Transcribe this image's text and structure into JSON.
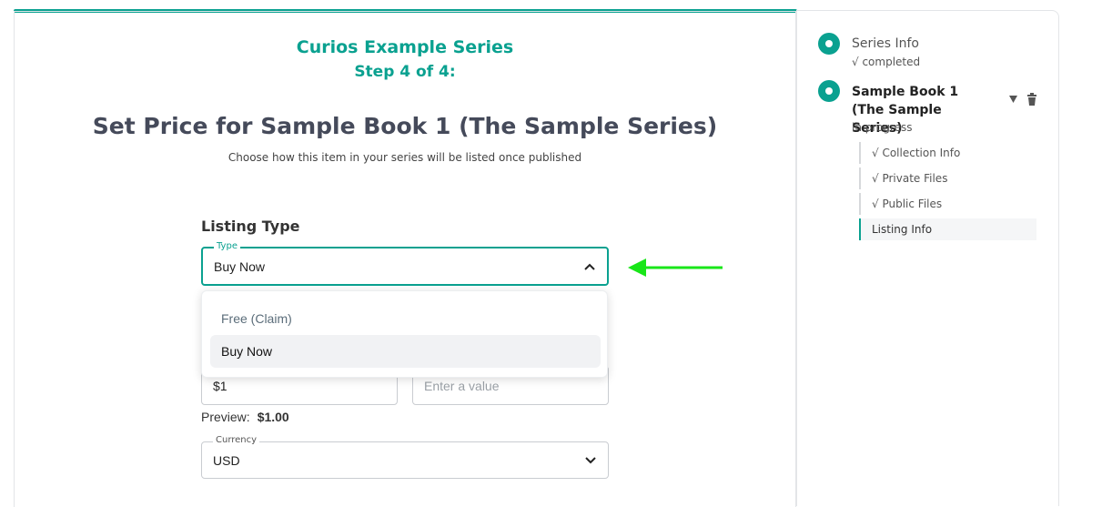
{
  "header": {
    "series_title": "Curios Example Series",
    "step_indicator": "Step 4 of 4:",
    "page_title": "Set Price for Sample Book 1 (The Sample Series)",
    "page_subtitle": "Choose how this item in your series will be listed once published"
  },
  "progress": {
    "fraction": 1.0
  },
  "listing": {
    "section_label": "Listing Type",
    "type_legend": "Type",
    "type_value": "Buy Now",
    "options": [
      "Free (Claim)",
      "Buy Now"
    ],
    "selected_option": "Buy Now"
  },
  "price": {
    "value": "$1",
    "second_placeholder": "Enter a value",
    "preview_label": "Preview:",
    "preview_value": "$1.00"
  },
  "currency": {
    "legend": "Currency",
    "value": "USD"
  },
  "sidebar": {
    "steps": [
      {
        "title": "Series Info",
        "status": "√ completed"
      },
      {
        "title": "Sample Book 1 (The Sample Series)",
        "status": "in progress"
      }
    ],
    "substeps": [
      "√ Collection Info",
      "√ Private Files",
      "√ Public Files",
      "Listing Info"
    ],
    "active_substep": "Listing Info",
    "expand_icon": "triangle-down-icon",
    "delete_icon": "trash-icon"
  },
  "colors": {
    "accent": "#0aa190",
    "annotation_arrow": "#19e619"
  }
}
